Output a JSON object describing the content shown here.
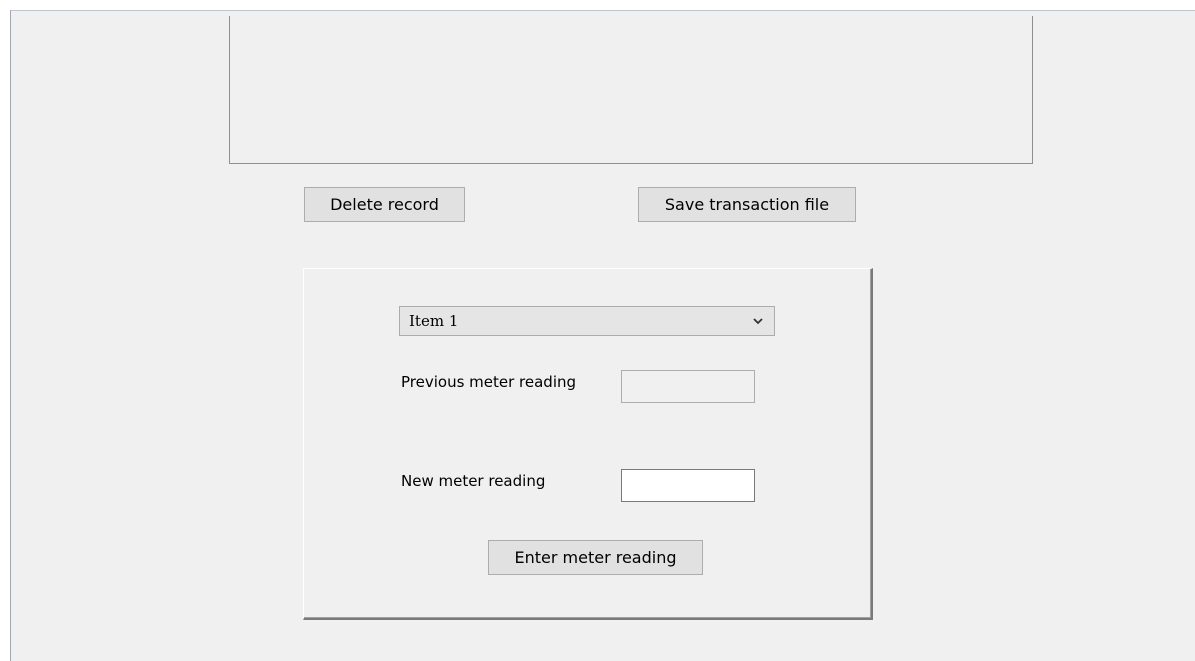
{
  "buttons": {
    "delete_record": "Delete record",
    "save_transaction_file": "Save transaction file",
    "enter_meter_reading": "Enter meter reading"
  },
  "meter_panel": {
    "item_select": {
      "selected": "Item 1",
      "icon": "chevron-down-icon"
    },
    "previous_reading": {
      "label": "Previous meter reading",
      "value": ""
    },
    "new_reading": {
      "label": "New meter reading",
      "value": ""
    }
  }
}
